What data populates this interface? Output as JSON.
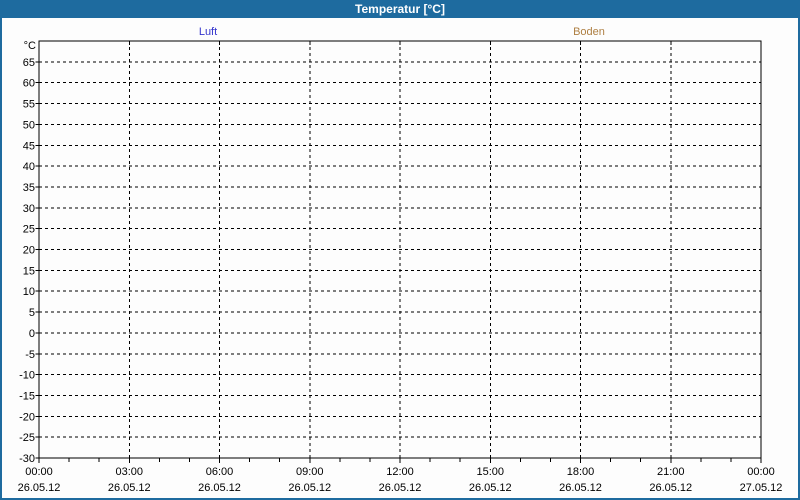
{
  "window": {
    "title": "Temperatur [°C]"
  },
  "colors": {
    "titlebar_bg": "#1e6b9f",
    "titlebar_text": "#ffffff",
    "page_border": "#1e6b9f",
    "plot_background": "#fdfdfd",
    "grid": "#000000",
    "axis_text": "#000000",
    "luft": "#3333cc",
    "boden": "#ae7f42"
  },
  "chart_data": {
    "type": "line",
    "title": "Temperatur [°C]",
    "ylabel": "°C",
    "xlabel": "",
    "grid": true,
    "legend_position": "top",
    "ylim": [
      -30,
      70
    ],
    "ytick_step": 5,
    "yticks": [
      65,
      60,
      55,
      50,
      45,
      40,
      35,
      30,
      25,
      20,
      15,
      10,
      5,
      0,
      -5,
      -10,
      -15,
      -20,
      -25,
      -30
    ],
    "x_minor_per_major": 3,
    "xticks": [
      {
        "time": "00:00",
        "date": "26.05.12"
      },
      {
        "time": "03:00",
        "date": "26.05.12"
      },
      {
        "time": "06:00",
        "date": "26.05.12"
      },
      {
        "time": "09:00",
        "date": "26.05.12"
      },
      {
        "time": "12:00",
        "date": "26.05.12"
      },
      {
        "time": "15:00",
        "date": "26.05.12"
      },
      {
        "time": "18:00",
        "date": "26.05.12"
      },
      {
        "time": "21:00",
        "date": "26.05.12"
      },
      {
        "time": "00:00",
        "date": "27.05.12"
      }
    ],
    "series": [
      {
        "name": "Luft",
        "color": "#3333cc",
        "values": []
      },
      {
        "name": "Boden",
        "color": "#ae7f42",
        "values": []
      }
    ]
  }
}
